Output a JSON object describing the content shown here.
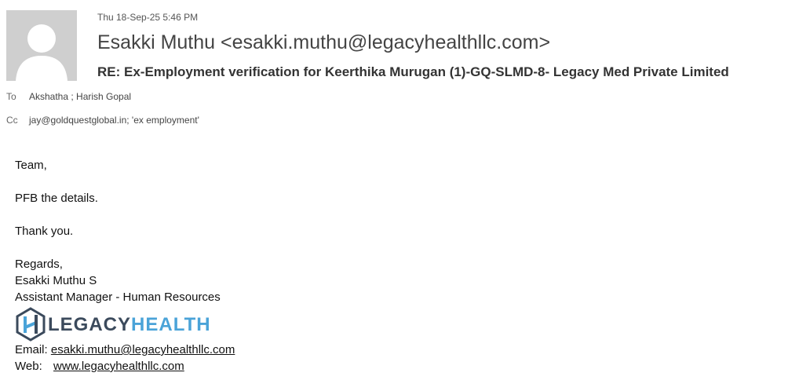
{
  "email": {
    "date": "Thu 18-Sep-25 5:46 PM",
    "from": "Esakki Muthu <esakki.muthu@legacyhealthllc.com>",
    "subject": "RE: Ex-Employment verification for Keerthika Murugan (1)-GQ-SLMD-8-  Legacy Med Private Limited",
    "to_label": "To",
    "to_value": "Akshatha ; Harish Gopal",
    "cc_label": "Cc",
    "cc_value": "jay@goldquestglobal.in; 'ex employment'"
  },
  "body": {
    "greeting": "Team,",
    "line1": "PFB the details.",
    "line2": "Thank you.",
    "closing": "Regards,",
    "sig_name": "Esakki Muthu S",
    "sig_title": "Assistant Manager - Human Resources",
    "logo_part1": "LEGACY",
    "logo_part2": "HEALTH",
    "email_label": "Email:",
    "email_link": "esakki.muthu@legacyhealthllc.com",
    "web_label": "Web:",
    "web_link": "www.legacyhealthllc.com"
  },
  "icons": {
    "avatar": "person-placeholder-icon",
    "logo": "legacy-health-logo-icon"
  },
  "colors": {
    "logo_dark": "#3b4a5c",
    "logo_blue": "#4aa3d8",
    "avatar_bg": "#cfcfcf"
  }
}
